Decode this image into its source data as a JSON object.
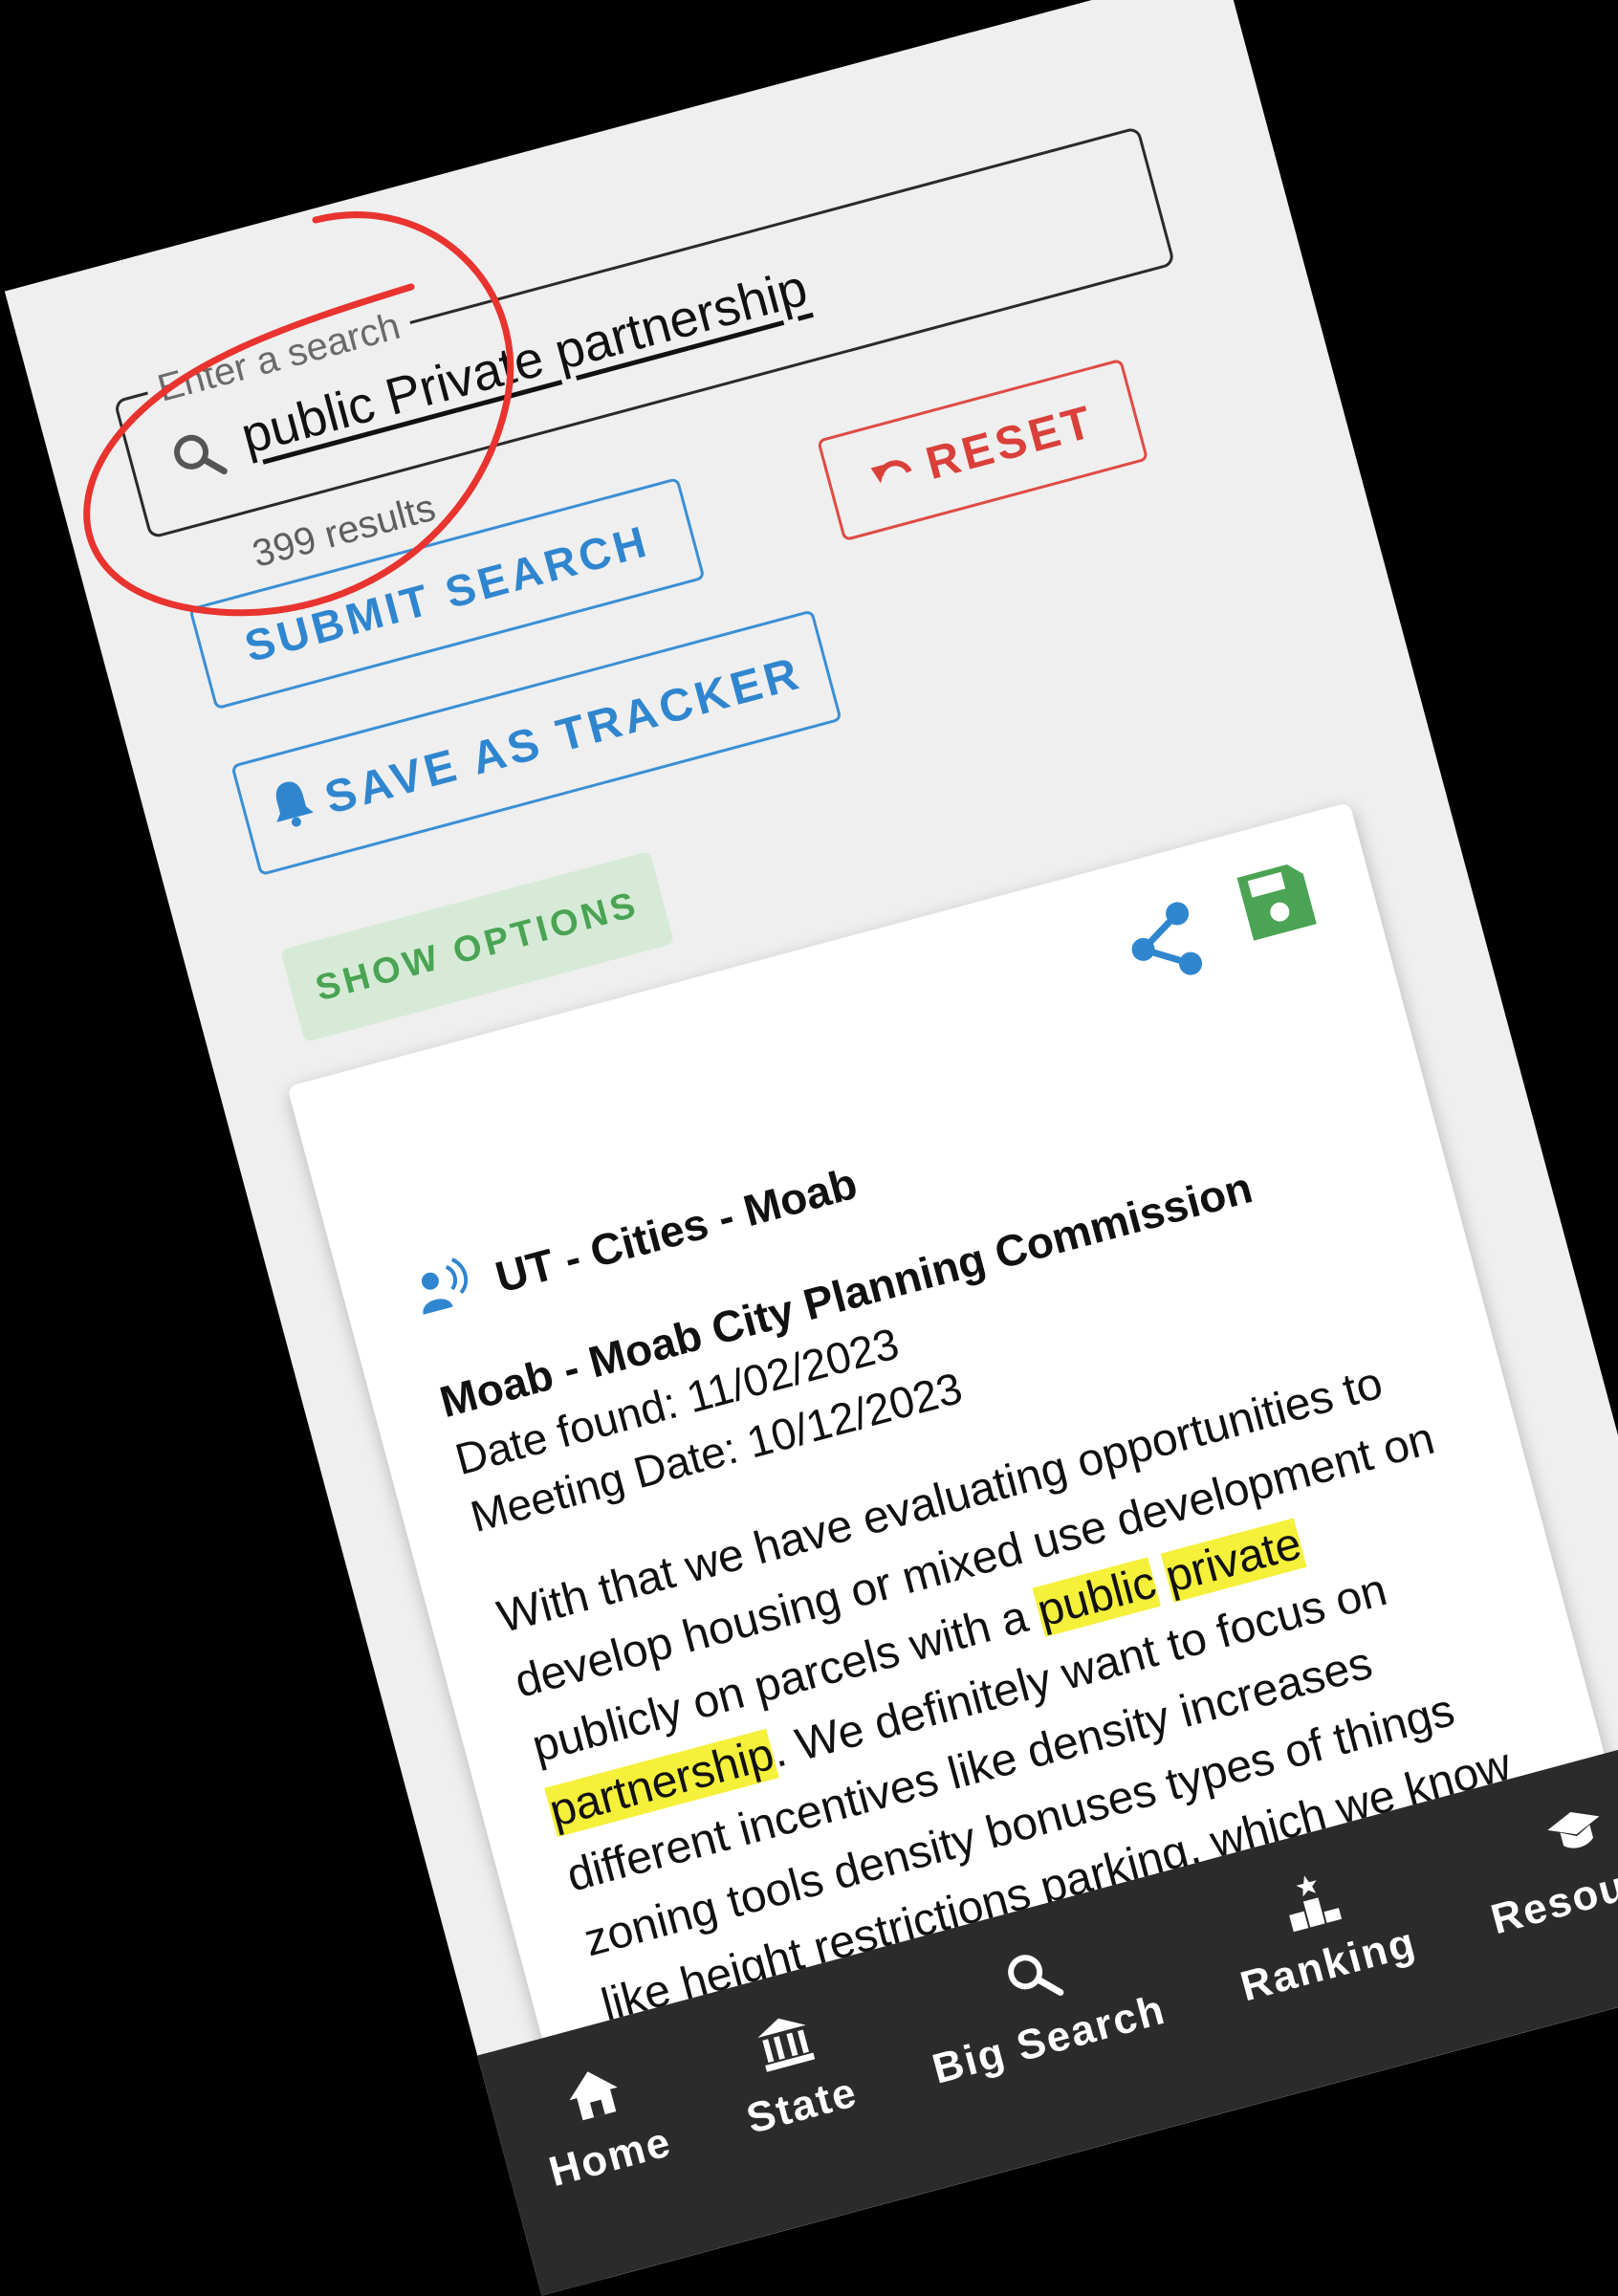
{
  "search": {
    "legend": "Enter a search",
    "value": "public Private partnership",
    "result_count": "399 results"
  },
  "buttons": {
    "submit": "SUBMIT SEARCH",
    "reset": "RESET",
    "save_tracker": "SAVE AS TRACKER",
    "show_options": "SHOW OPTIONS"
  },
  "colors": {
    "blue": "#2f86cf",
    "red": "#d9403a",
    "green": "#4aa453",
    "highlight": "#f5f03a",
    "nav_bg": "#2b2b2b"
  },
  "card": {
    "org": "UT - Cities - Moab",
    "title": "Moab - Moab City Planning Commission",
    "date_found": "Date found: 11/02/2023",
    "meeting_date": "Meeting Date: 10/12/2023",
    "excerpt": {
      "part1": "With that we have evaluating opportunities to develop housing or mixed use development on publicly on parcels with a ",
      "hl1": "public",
      "space1": " ",
      "hl2": "private",
      "space2": " ",
      "hl3": "partnership",
      "part2": ". We definitely want to focus on different incentives like density increases zoning tools density bonuses types of things like height restrictions parking, which we know has been in the works and done but continue those even to a higher level."
    }
  },
  "nav": [
    {
      "label": "Home",
      "icon": "home-icon"
    },
    {
      "label": "State",
      "icon": "bank-icon"
    },
    {
      "label": "Big Search",
      "icon": "search-icon"
    },
    {
      "label": "Ranking",
      "icon": "podium-icon"
    },
    {
      "label": "Resource",
      "icon": "graduation-cap-icon"
    }
  ]
}
